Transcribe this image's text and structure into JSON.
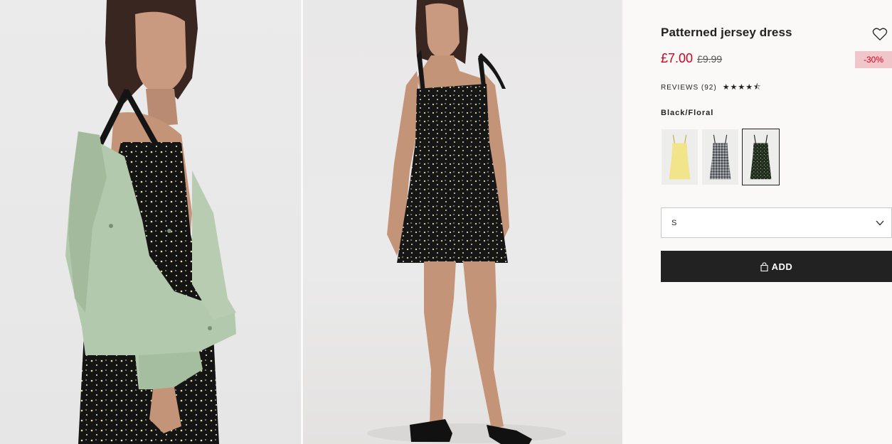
{
  "product": {
    "title": "Patterned jersey dress",
    "price_current": "£7.00",
    "price_original": "£9.99",
    "discount": "-30%",
    "reviews_label": "REVIEWS (92)",
    "rating": 4.5,
    "stars": "★★★★⯪",
    "color_name": "Black/Floral",
    "swatches": [
      {
        "name": "Yellow",
        "selected": false
      },
      {
        "name": "Grey/Check",
        "selected": false
      },
      {
        "name": "Black/Floral",
        "selected": true
      }
    ],
    "size_selected": "S",
    "add_label": "ADD"
  },
  "icons": {
    "favorite": "heart-outline-icon",
    "dropdown": "chevron-down-icon",
    "bag": "shopping-bag-icon"
  },
  "colors": {
    "price_red": "#d6001c",
    "discount_bg": "#f0c6ca",
    "button_bg": "#222222"
  }
}
